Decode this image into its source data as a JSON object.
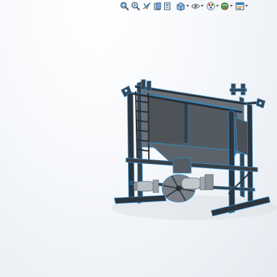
{
  "toolbar": {
    "items": [
      {
        "icon": "zoom-to-fit-icon"
      },
      {
        "icon": "zoom-to-area-icon"
      },
      {
        "icon": "previous-view-icon"
      },
      {
        "icon": "section-view-icon"
      },
      {
        "icon": "view-orientation-icon",
        "has_dropdown": true
      },
      {
        "icon": "display-style-icon",
        "has_dropdown": true
      },
      {
        "icon": "hide-show-items-icon",
        "has_dropdown": true
      },
      {
        "icon": "edit-appearance-icon",
        "has_dropdown": true
      },
      {
        "icon": "apply-scene-icon",
        "has_dropdown": true
      },
      {
        "icon": "view-settings-icon",
        "has_dropdown": true
      }
    ]
  },
  "colors": {
    "frame_steel": "#3c424a",
    "edge_highlight": "#2f8fd0",
    "hopper_panel": "#545a61",
    "motor_body": "#b9bec4",
    "background_top": "#ffffff",
    "background_bottom": "#e6eaf0"
  }
}
